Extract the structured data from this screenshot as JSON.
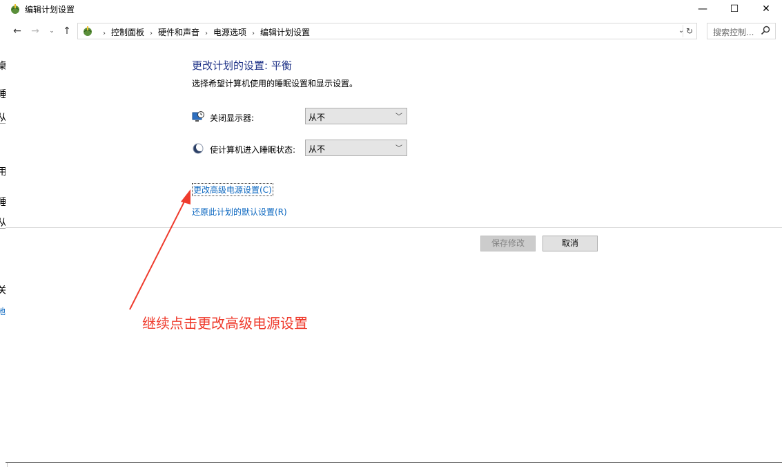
{
  "window": {
    "title": "编辑计划设置",
    "controls": {
      "minimize": "—",
      "maximize": "☐",
      "close": "✕"
    }
  },
  "background": {
    "glyphs": [
      "桌",
      "睡",
      "从",
      "用",
      "睡",
      "从",
      "关",
      "地"
    ]
  },
  "address_bar": {
    "back": "←",
    "forward": "→",
    "recent": "⌄",
    "up": "↑",
    "breadcrumbs": [
      "控制面板",
      "硬件和声音",
      "电源选项",
      "编辑计划设置"
    ],
    "separator": "›",
    "dropdown": "⌄",
    "refresh": "↻",
    "search_placeholder": "搜索控制..."
  },
  "main": {
    "title": "更改计划的设置: 平衡",
    "description": "选择希望计算机使用的睡眠设置和显示设置。",
    "settings": [
      {
        "label": "关闭显示器:",
        "value": "从不",
        "icon": "monitor-icon"
      },
      {
        "label": "使计算机进入睡眠状态:",
        "value": "从不",
        "icon": "sleep-moon-icon"
      }
    ],
    "links": {
      "advanced": "更改高级电源设置(C)",
      "restore": "还原此计划的默认设置(R)"
    },
    "buttons": {
      "save": "保存修改",
      "cancel": "取消"
    }
  },
  "annotation": {
    "text": "继续点击更改高级电源设置",
    "color": "#ef3b2d"
  },
  "colors": {
    "title": "#1e3287",
    "link": "#0b67c0",
    "annotation": "#ef3b2d"
  }
}
